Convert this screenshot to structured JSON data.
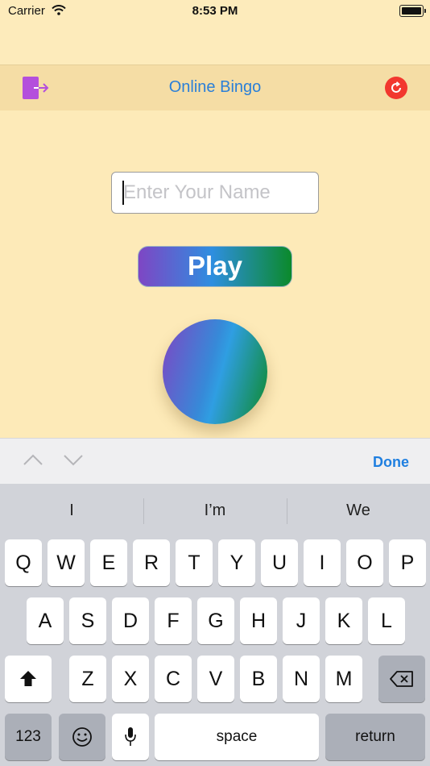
{
  "status_bar": {
    "carrier": "Carrier",
    "time": "8:53 PM"
  },
  "nav": {
    "title": "Online Bingo"
  },
  "name_input": {
    "placeholder": "Enter Your Name",
    "value": ""
  },
  "play_button": {
    "label": "Play"
  },
  "accessory": {
    "done_label": "Done"
  },
  "keyboard": {
    "suggestions": [
      "I",
      "I’m",
      "We"
    ],
    "row1": [
      "Q",
      "W",
      "E",
      "R",
      "T",
      "Y",
      "U",
      "I",
      "O",
      "P"
    ],
    "row2": [
      "A",
      "S",
      "D",
      "F",
      "G",
      "H",
      "J",
      "K",
      "L"
    ],
    "row3": [
      "Z",
      "X",
      "C",
      "V",
      "B",
      "N",
      "M"
    ],
    "numbers_label": "123",
    "space_label": "space",
    "return_label": "return"
  },
  "colors": {
    "background": "#fdeab8",
    "navbar": "#f5dda5",
    "title_blue": "#2a7fd8",
    "logout_purple": "#b44fdc",
    "refresh_red": "#f2372e",
    "gradient": [
      "#7e46c4",
      "#2e8ee0",
      "#0b8a2b"
    ]
  },
  "icons": [
    "wifi-icon",
    "battery-icon",
    "logout-icon",
    "refresh-icon",
    "chevron-up-icon",
    "chevron-down-icon",
    "shift-icon",
    "backspace-icon",
    "emoji-icon",
    "microphone-icon"
  ]
}
